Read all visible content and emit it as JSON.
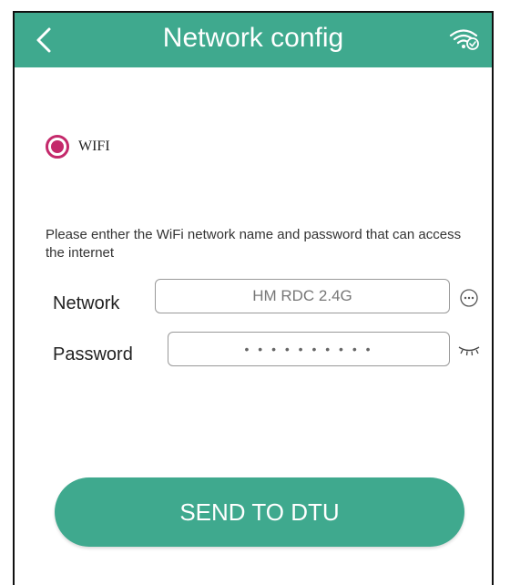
{
  "header": {
    "title": "Network config",
    "back_icon": "chevron-left-icon",
    "right_icon": "wifi-check-icon"
  },
  "mode": {
    "options": [
      {
        "label": "WIFI",
        "selected": true
      }
    ]
  },
  "instruction": "Please enther the WiFi network name and password that can access the internet",
  "form": {
    "network_label": "Network",
    "network_value": "HM  RDC  2.4G",
    "network_more_icon": "more-options-icon",
    "password_label": "Password",
    "password_value": "• • • • • • • • • •",
    "password_toggle_icon": "eye-closed-icon"
  },
  "actions": {
    "send_label": "SEND TO DTU"
  },
  "colors": {
    "accent": "#3fa98e",
    "radio": "#c4296b"
  }
}
